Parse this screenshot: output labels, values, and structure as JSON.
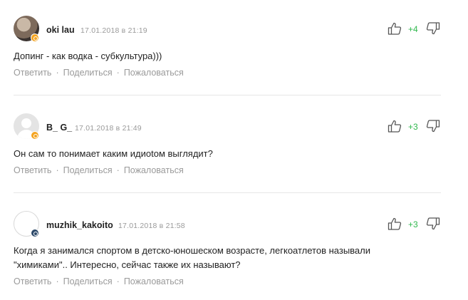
{
  "comments": [
    {
      "author": "oki lau",
      "date": "17.01.2018 в 21:19",
      "score": "+4",
      "text": "Допинг - как водка - субкультура)))",
      "actions": {
        "reply": "Ответить",
        "share": "Поделиться",
        "report": "Пожаловаться"
      }
    },
    {
      "author": "B_ G_",
      "date": "17.01.2018 в 21:49",
      "score": "+3",
      "text": "Он сам то понимает каким идиоtом выглядит?",
      "actions": {
        "reply": "Ответить",
        "share": "Поделиться",
        "report": "Пожаловаться"
      }
    },
    {
      "author": "muzhik_kakoito",
      "date": "17.01.2018 в 21:58",
      "score": "+3",
      "text_line1": "Когда я занимался спортом в детско-юношеском возрасте, легкоатлетов называли",
      "text_line2": "\"химиками\".. Интересно, сейчас также их называют?",
      "actions": {
        "reply": "Ответить",
        "share": "Поделиться",
        "report": "Пожаловаться"
      }
    }
  ],
  "icons": {
    "like": "thumbs-up-icon",
    "dislike": "thumbs-down-icon"
  },
  "colors": {
    "score": "#2eb84c",
    "meta": "#9a9a9a",
    "badge_orange": "#f4a31f",
    "badge_navy": "#2d4a6a"
  }
}
